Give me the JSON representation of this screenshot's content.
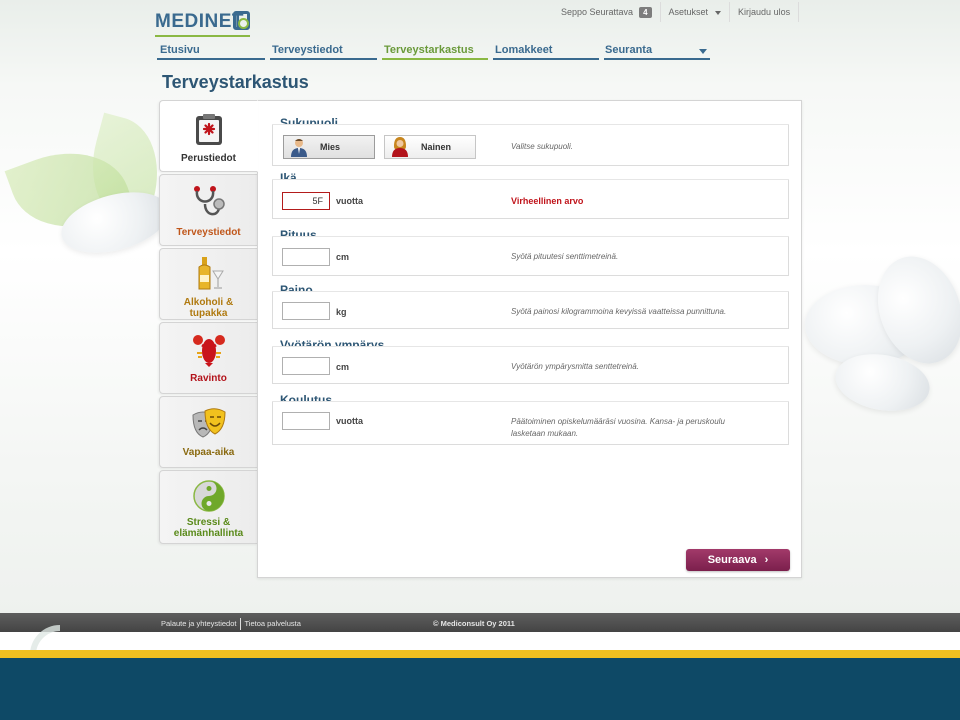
{
  "header": {
    "logo_text": "MEDINET",
    "user_name": "Seppo Seurattava",
    "user_badge": "4",
    "settings_label": "Asetukset",
    "logout_label": "Kirjaudu ulos"
  },
  "nav": {
    "items": [
      {
        "label": "Etusivu",
        "active": false
      },
      {
        "label": "Terveystiedot",
        "active": false
      },
      {
        "label": "Terveystarkastus",
        "active": true
      },
      {
        "label": "Lomakkeet",
        "active": false
      },
      {
        "label": "Seuranta",
        "active": false
      }
    ]
  },
  "page_title": "Terveystarkastus",
  "side_tabs": [
    {
      "label": "Perustiedot",
      "icon": "clipboard-icon",
      "color": "#333333",
      "active": true
    },
    {
      "label": "Terveystiedot",
      "icon": "stethoscope-icon",
      "color": "#c0571b",
      "active": false
    },
    {
      "label": "Alkoholi & tupakka",
      "icon": "bottle-glass-icon",
      "color": "#b07a10",
      "active": false
    },
    {
      "label": "Ravinto",
      "icon": "lobster-icon",
      "color": "#b3131b",
      "active": false
    },
    {
      "label": "Vapaa-aika",
      "icon": "theater-masks-icon",
      "color": "#8a6a10",
      "active": false
    },
    {
      "label": "Stressi & elämänhallinta",
      "icon": "yin-yang-icon",
      "color": "#5a8a1a",
      "active": false
    }
  ],
  "form": {
    "gender": {
      "title": "Sukupuoli",
      "male_label": "Mies",
      "female_label": "Nainen",
      "selected": "Mies",
      "hint": "Valitse sukupuoli."
    },
    "age": {
      "title": "Ikä",
      "value": "5F",
      "unit": "vuotta",
      "error": "Virheellinen arvo"
    },
    "height": {
      "title": "Pituus",
      "value": "",
      "unit": "cm",
      "hint": "Syötä pituutesi senttimetreinä."
    },
    "weight": {
      "title": "Paino",
      "value": "",
      "unit": "kg",
      "hint": "Syötä painosi kilogrammoina kevyissä vaatteissa punnittuna."
    },
    "waist": {
      "title": "Vyötärön ympärys",
      "value": "",
      "unit": "cm",
      "hint": "Vyötärön ympärysmitta senttetreinä."
    },
    "education": {
      "title": "Koulutus",
      "value": "",
      "unit": "vuotta",
      "hint_line1": "Päätoiminen opiskelumääräsi vuosina. Kansa- ja peruskoulu",
      "hint_line2": "lasketaan mukaan."
    },
    "next_label": "Seuraava"
  },
  "footer": {
    "feedback_link": "Palaute ja yhteystiedot",
    "about_link": "Tietoa palvelusta",
    "copyright": "© Mediconsult Oy 2011"
  },
  "colors": {
    "brand_blue": "#3a6a8f",
    "brand_green": "#8ab843",
    "next_button": "#8c2b5b",
    "error_red": "#c0141b",
    "footer_bar": "#4f4f4f",
    "bottom_band": "#0e4966",
    "accent_yellow": "#f0c020"
  }
}
